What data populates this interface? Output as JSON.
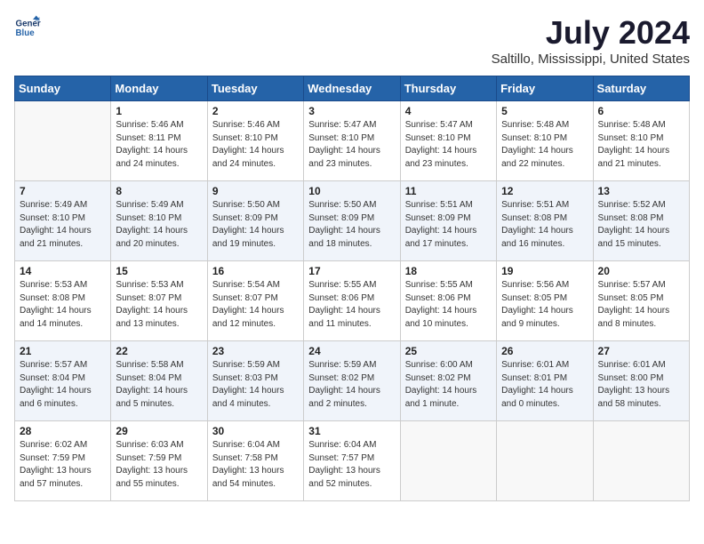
{
  "logo": {
    "line1": "General",
    "line2": "Blue"
  },
  "title": "July 2024",
  "subtitle": "Saltillo, Mississippi, United States",
  "headers": [
    "Sunday",
    "Monday",
    "Tuesday",
    "Wednesday",
    "Thursday",
    "Friday",
    "Saturday"
  ],
  "weeks": [
    [
      {
        "day": "",
        "sunrise": "",
        "sunset": "",
        "daylight": ""
      },
      {
        "day": "1",
        "sunrise": "Sunrise: 5:46 AM",
        "sunset": "Sunset: 8:11 PM",
        "daylight": "Daylight: 14 hours and 24 minutes."
      },
      {
        "day": "2",
        "sunrise": "Sunrise: 5:46 AM",
        "sunset": "Sunset: 8:10 PM",
        "daylight": "Daylight: 14 hours and 24 minutes."
      },
      {
        "day": "3",
        "sunrise": "Sunrise: 5:47 AM",
        "sunset": "Sunset: 8:10 PM",
        "daylight": "Daylight: 14 hours and 23 minutes."
      },
      {
        "day": "4",
        "sunrise": "Sunrise: 5:47 AM",
        "sunset": "Sunset: 8:10 PM",
        "daylight": "Daylight: 14 hours and 23 minutes."
      },
      {
        "day": "5",
        "sunrise": "Sunrise: 5:48 AM",
        "sunset": "Sunset: 8:10 PM",
        "daylight": "Daylight: 14 hours and 22 minutes."
      },
      {
        "day": "6",
        "sunrise": "Sunrise: 5:48 AM",
        "sunset": "Sunset: 8:10 PM",
        "daylight": "Daylight: 14 hours and 21 minutes."
      }
    ],
    [
      {
        "day": "7",
        "sunrise": "Sunrise: 5:49 AM",
        "sunset": "Sunset: 8:10 PM",
        "daylight": "Daylight: 14 hours and 21 minutes."
      },
      {
        "day": "8",
        "sunrise": "Sunrise: 5:49 AM",
        "sunset": "Sunset: 8:10 PM",
        "daylight": "Daylight: 14 hours and 20 minutes."
      },
      {
        "day": "9",
        "sunrise": "Sunrise: 5:50 AM",
        "sunset": "Sunset: 8:09 PM",
        "daylight": "Daylight: 14 hours and 19 minutes."
      },
      {
        "day": "10",
        "sunrise": "Sunrise: 5:50 AM",
        "sunset": "Sunset: 8:09 PM",
        "daylight": "Daylight: 14 hours and 18 minutes."
      },
      {
        "day": "11",
        "sunrise": "Sunrise: 5:51 AM",
        "sunset": "Sunset: 8:09 PM",
        "daylight": "Daylight: 14 hours and 17 minutes."
      },
      {
        "day": "12",
        "sunrise": "Sunrise: 5:51 AM",
        "sunset": "Sunset: 8:08 PM",
        "daylight": "Daylight: 14 hours and 16 minutes."
      },
      {
        "day": "13",
        "sunrise": "Sunrise: 5:52 AM",
        "sunset": "Sunset: 8:08 PM",
        "daylight": "Daylight: 14 hours and 15 minutes."
      }
    ],
    [
      {
        "day": "14",
        "sunrise": "Sunrise: 5:53 AM",
        "sunset": "Sunset: 8:08 PM",
        "daylight": "Daylight: 14 hours and 14 minutes."
      },
      {
        "day": "15",
        "sunrise": "Sunrise: 5:53 AM",
        "sunset": "Sunset: 8:07 PM",
        "daylight": "Daylight: 14 hours and 13 minutes."
      },
      {
        "day": "16",
        "sunrise": "Sunrise: 5:54 AM",
        "sunset": "Sunset: 8:07 PM",
        "daylight": "Daylight: 14 hours and 12 minutes."
      },
      {
        "day": "17",
        "sunrise": "Sunrise: 5:55 AM",
        "sunset": "Sunset: 8:06 PM",
        "daylight": "Daylight: 14 hours and 11 minutes."
      },
      {
        "day": "18",
        "sunrise": "Sunrise: 5:55 AM",
        "sunset": "Sunset: 8:06 PM",
        "daylight": "Daylight: 14 hours and 10 minutes."
      },
      {
        "day": "19",
        "sunrise": "Sunrise: 5:56 AM",
        "sunset": "Sunset: 8:05 PM",
        "daylight": "Daylight: 14 hours and 9 minutes."
      },
      {
        "day": "20",
        "sunrise": "Sunrise: 5:57 AM",
        "sunset": "Sunset: 8:05 PM",
        "daylight": "Daylight: 14 hours and 8 minutes."
      }
    ],
    [
      {
        "day": "21",
        "sunrise": "Sunrise: 5:57 AM",
        "sunset": "Sunset: 8:04 PM",
        "daylight": "Daylight: 14 hours and 6 minutes."
      },
      {
        "day": "22",
        "sunrise": "Sunrise: 5:58 AM",
        "sunset": "Sunset: 8:04 PM",
        "daylight": "Daylight: 14 hours and 5 minutes."
      },
      {
        "day": "23",
        "sunrise": "Sunrise: 5:59 AM",
        "sunset": "Sunset: 8:03 PM",
        "daylight": "Daylight: 14 hours and 4 minutes."
      },
      {
        "day": "24",
        "sunrise": "Sunrise: 5:59 AM",
        "sunset": "Sunset: 8:02 PM",
        "daylight": "Daylight: 14 hours and 2 minutes."
      },
      {
        "day": "25",
        "sunrise": "Sunrise: 6:00 AM",
        "sunset": "Sunset: 8:02 PM",
        "daylight": "Daylight: 14 hours and 1 minute."
      },
      {
        "day": "26",
        "sunrise": "Sunrise: 6:01 AM",
        "sunset": "Sunset: 8:01 PM",
        "daylight": "Daylight: 14 hours and 0 minutes."
      },
      {
        "day": "27",
        "sunrise": "Sunrise: 6:01 AM",
        "sunset": "Sunset: 8:00 PM",
        "daylight": "Daylight: 13 hours and 58 minutes."
      }
    ],
    [
      {
        "day": "28",
        "sunrise": "Sunrise: 6:02 AM",
        "sunset": "Sunset: 7:59 PM",
        "daylight": "Daylight: 13 hours and 57 minutes."
      },
      {
        "day": "29",
        "sunrise": "Sunrise: 6:03 AM",
        "sunset": "Sunset: 7:59 PM",
        "daylight": "Daylight: 13 hours and 55 minutes."
      },
      {
        "day": "30",
        "sunrise": "Sunrise: 6:04 AM",
        "sunset": "Sunset: 7:58 PM",
        "daylight": "Daylight: 13 hours and 54 minutes."
      },
      {
        "day": "31",
        "sunrise": "Sunrise: 6:04 AM",
        "sunset": "Sunset: 7:57 PM",
        "daylight": "Daylight: 13 hours and 52 minutes."
      },
      {
        "day": "",
        "sunrise": "",
        "sunset": "",
        "daylight": ""
      },
      {
        "day": "",
        "sunrise": "",
        "sunset": "",
        "daylight": ""
      },
      {
        "day": "",
        "sunrise": "",
        "sunset": "",
        "daylight": ""
      }
    ]
  ]
}
